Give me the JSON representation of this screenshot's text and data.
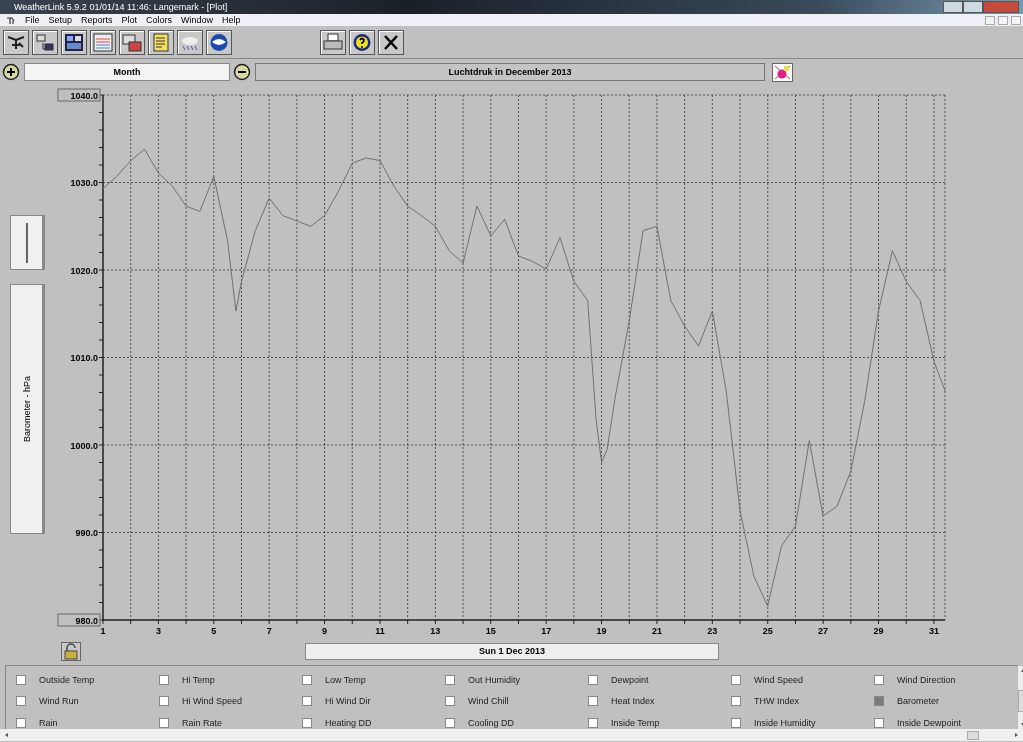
{
  "window": {
    "title": "WeatherLink 5.9.2  01/01/14  11:46: Langemark - [Plot]"
  },
  "menu": [
    "File",
    "Setup",
    "Reports",
    "Plot",
    "Colors",
    "Window",
    "Help"
  ],
  "toolbar": {
    "left": [
      {
        "kind": "station"
      },
      {
        "kind": "download"
      },
      {
        "kind": "bulletin"
      },
      {
        "kind": "plot"
      },
      {
        "kind": "strip"
      },
      {
        "kind": "notes"
      },
      {
        "kind": "weather"
      },
      {
        "kind": "noaa"
      }
    ],
    "right": [
      {
        "kind": "print"
      },
      {
        "kind": "help"
      },
      {
        "kind": "close"
      }
    ]
  },
  "span": {
    "value": "Month"
  },
  "plot_title": "Luchtdruk in December 2013",
  "axis_label": "Barometer - hPa",
  "chart": {
    "chart_data": {
      "type": "line",
      "x": [
        1,
        1.5,
        2,
        2.5,
        3,
        3.5,
        4,
        4.5,
        5,
        5.5,
        5.8,
        6,
        6.5,
        7,
        7.5,
        8,
        8.5,
        9,
        9.5,
        10,
        10.5,
        11,
        11.5,
        12,
        12.5,
        13,
        13.5,
        14,
        14.5,
        15,
        15.5,
        16,
        16.5,
        17,
        17.5,
        18,
        18.5,
        18.8,
        19,
        19.2,
        19.5,
        20,
        20.5,
        21,
        21.5,
        22,
        22.5,
        23,
        23.5,
        24,
        24.5,
        25,
        25.5,
        26,
        26.5,
        27,
        27.5,
        28,
        28.5,
        29,
        29.5,
        30,
        30.5,
        31,
        31.4
      ],
      "grid": true,
      "series": [
        {
          "color": "#707070",
          "values": [
            1029.3,
            1030.7,
            1032.5,
            1033.8,
            1031.1,
            1029.6,
            1027.3,
            1026.7,
            1030.7,
            1023.3,
            1015.3,
            1018.7,
            1024.5,
            1028.2,
            1026.2,
            1025.6,
            1025,
            1026.2,
            1029,
            1032.2,
            1032.8,
            1032.5,
            1029.6,
            1027.3,
            1026.2,
            1025,
            1022.2,
            1020.8,
            1027.3,
            1023.9,
            1025.8,
            1021.6,
            1021,
            1020.1,
            1023.7,
            1018.7,
            1016.5,
            1003,
            998,
            999.5,
            1005.6,
            1014.2,
            1024.5,
            1025,
            1016.5,
            1013.6,
            1011.3,
            1015.3,
            1006.2,
            992.5,
            985,
            981.6,
            988.5,
            990.7,
            1000.5,
            991.9,
            993,
            997,
            1005,
            1015.3,
            1022.2,
            1018.7,
            1016.5,
            1009.6,
            1006.2
          ]
        }
      ],
      "xlim": [
        1,
        31.4
      ],
      "ylim": [
        980,
        1040
      ],
      "xticks": [
        1,
        3,
        5,
        7,
        9,
        11,
        13,
        15,
        17,
        19,
        21,
        23,
        25,
        27,
        29,
        31
      ],
      "yticks": [
        {
          "value": 980,
          "label": "980.0"
        },
        {
          "value": 990,
          "label": "990.0"
        },
        {
          "value": 1000,
          "label": "1000.0"
        },
        {
          "value": 1010,
          "label": "1010.0"
        },
        {
          "value": 1020,
          "label": "1020.0"
        },
        {
          "value": 1030,
          "label": "1030.0"
        },
        {
          "value": 1040,
          "label": "1040.0"
        }
      ]
    }
  },
  "date_bar": "Sun 1 Dec 2013",
  "channels": [
    {
      "label": "Outside Temp",
      "checked": false
    },
    {
      "label": "Hi Temp",
      "checked": false
    },
    {
      "label": "Low Temp",
      "checked": false
    },
    {
      "label": "Out Humidity",
      "checked": false
    },
    {
      "label": "Dewpoint",
      "checked": false
    },
    {
      "label": "Wind Speed",
      "checked": false
    },
    {
      "label": "Wind Direction",
      "checked": false
    },
    {
      "label": "Wind Run",
      "checked": false
    },
    {
      "label": "Hi Wind Speed",
      "checked": false
    },
    {
      "label": "Hi Wind Dir",
      "checked": false
    },
    {
      "label": "Wind Chill",
      "checked": false
    },
    {
      "label": "Heat Index",
      "checked": false
    },
    {
      "label": "THW Index",
      "checked": false
    },
    {
      "label": "Barometer",
      "checked": true
    },
    {
      "label": "Rain",
      "checked": false
    },
    {
      "label": "Rain Rate",
      "checked": false
    },
    {
      "label": "Heating DD",
      "checked": false
    },
    {
      "label": "Cooling DD",
      "checked": false
    },
    {
      "label": "Inside Temp",
      "checked": false
    },
    {
      "label": "Inside Humidity",
      "checked": false
    },
    {
      "label": "Inside Dewpoint",
      "checked": false
    }
  ]
}
